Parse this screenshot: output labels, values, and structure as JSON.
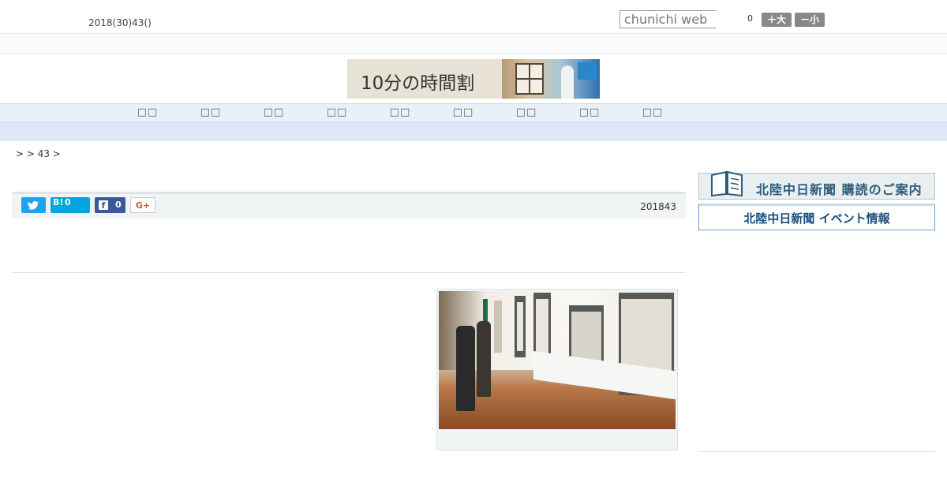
{
  "header": {
    "date": "2018(30)43()",
    "search_placeholder": "chunichi web",
    "font_size_count": "0",
    "font_large_label": "＋大",
    "font_small_label": "－小"
  },
  "banner": {
    "text": "10分の時間割"
  },
  "nav": {
    "items": [
      {
        "label": "□□"
      },
      {
        "label": "□□"
      },
      {
        "label": "□□"
      },
      {
        "label": "□□"
      },
      {
        "label": "□□"
      },
      {
        "label": "□□"
      },
      {
        "label": "□□"
      },
      {
        "label": "□□"
      },
      {
        "label": "□□"
      }
    ]
  },
  "breadcrumb": {
    "text": ">  > 43 >"
  },
  "article": {
    "hatena_count": "0",
    "facebook_count": "0",
    "googleplus_label": "G+",
    "twitter_icon": "twitter-bird",
    "hatena_label": "B!",
    "facebook_icon": "facebook-f",
    "pub_date": "201843"
  },
  "sidebar": {
    "subscription_banner": "北陸中日新聞 購読のご案内",
    "event_banner": "北陸中日新聞 イベント情報"
  },
  "colors": {
    "twitter": "#1da1f2",
    "hatena": "#00a4de",
    "facebook": "#3b5998",
    "googleplus": "#dc4e41",
    "nav_bg": "#e8f0f8"
  }
}
